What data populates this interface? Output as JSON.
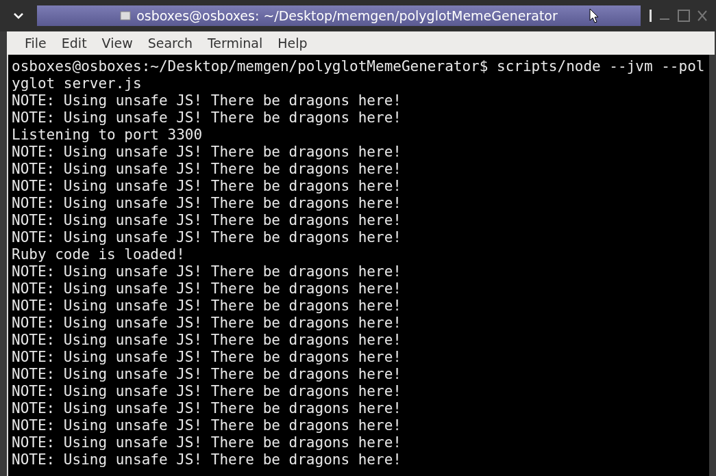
{
  "window": {
    "title": "osboxes@osboxes: ~/Desktop/memgen/polyglotMemeGenerator"
  },
  "menu": [
    "File",
    "Edit",
    "View",
    "Search",
    "Terminal",
    "Help"
  ],
  "terminal": {
    "lines": [
      "osboxes@osboxes:~/Desktop/memgen/polyglotMemeGenerator$ scripts/node --jvm --pol",
      "yglot server.js",
      "NOTE: Using unsafe JS! There be dragons here!",
      "NOTE: Using unsafe JS! There be dragons here!",
      "Listening to port 3300",
      "NOTE: Using unsafe JS! There be dragons here!",
      "NOTE: Using unsafe JS! There be dragons here!",
      "NOTE: Using unsafe JS! There be dragons here!",
      "NOTE: Using unsafe JS! There be dragons here!",
      "NOTE: Using unsafe JS! There be dragons here!",
      "NOTE: Using unsafe JS! There be dragons here!",
      "Ruby code is loaded!",
      "NOTE: Using unsafe JS! There be dragons here!",
      "NOTE: Using unsafe JS! There be dragons here!",
      "NOTE: Using unsafe JS! There be dragons here!",
      "NOTE: Using unsafe JS! There be dragons here!",
      "NOTE: Using unsafe JS! There be dragons here!",
      "NOTE: Using unsafe JS! There be dragons here!",
      "NOTE: Using unsafe JS! There be dragons here!",
      "NOTE: Using unsafe JS! There be dragons here!",
      "NOTE: Using unsafe JS! There be dragons here!",
      "NOTE: Using unsafe JS! There be dragons here!",
      "NOTE: Using unsafe JS! There be dragons here!",
      "NOTE: Using unsafe JS! There be dragons here!"
    ]
  }
}
